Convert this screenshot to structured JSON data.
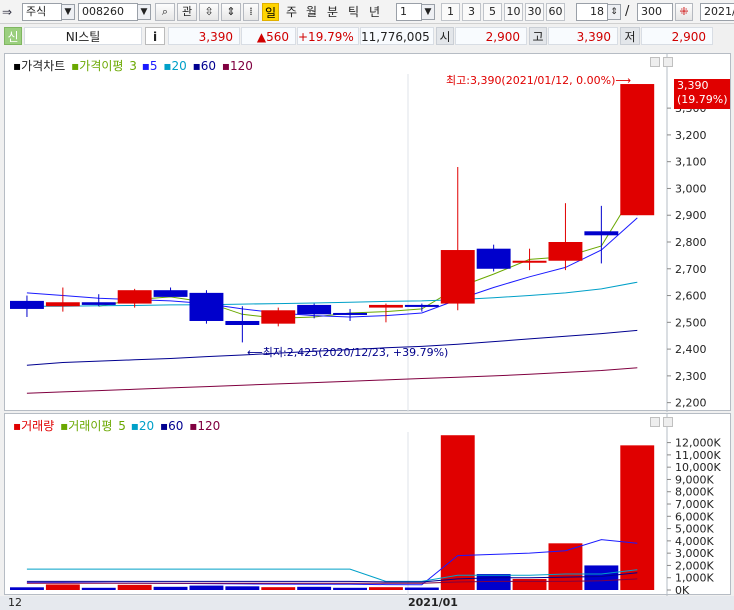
{
  "toolbar": {
    "market_value": "주식",
    "code_value": "008260",
    "watch_label": "관",
    "periods": [
      "일",
      "주",
      "월",
      "분",
      "틱",
      "년"
    ],
    "active_period": "일",
    "interval_value": "1",
    "interval_buttons": [
      "1",
      "3",
      "5",
      "10",
      "30",
      "60"
    ],
    "view_count": "18",
    "total_count": "300",
    "date_value": "2021/"
  },
  "info": {
    "credit_label": "신",
    "name": "NI스틸",
    "info_icon": "i",
    "price": "3,390",
    "change": "▲560",
    "change_rate": "+19.79%",
    "volume": "11,776,005",
    "open_label": "시",
    "open": "2,900",
    "high_label": "고",
    "high": "3,390",
    "low_label": "저",
    "low": "2,900"
  },
  "price_pane": {
    "legend": [
      "가격차트",
      "가격이평",
      "3",
      "5",
      "20",
      "60",
      "120"
    ],
    "max_annotation": "최고:3,390(2021/01/12, 0.00%)⟶",
    "min_annotation": "⟵최저:2,425(2020/12/23, +39.79%)",
    "current_price_tag": "3,390",
    "current_rate_tag": "(19.79%)"
  },
  "volume_pane": {
    "legend": [
      "거래량",
      "거래이평",
      "5",
      "20",
      "60",
      "120"
    ]
  },
  "x_axis": {
    "left_label": "12",
    "month_label": "2021/01"
  },
  "colors": {
    "up": "#e00000",
    "down": "#0000cc",
    "ma3": "#6aa800",
    "ma5": "#1a1aff",
    "ma20": "#00a0c8",
    "ma60": "#000090",
    "ma120": "#800040",
    "active_period_bg": "#ffd400"
  },
  "chart_data": [
    {
      "type": "candlestick",
      "title": "가격차트",
      "y_ticks": [
        2200,
        2300,
        2400,
        2500,
        2600,
        2700,
        2800,
        2900,
        3000,
        3100,
        3200,
        3300
      ],
      "ylim": [
        2180,
        3420
      ],
      "candles": [
        {
          "o": 2580,
          "h": 2600,
          "l": 2520,
          "c": 2550
        },
        {
          "o": 2560,
          "h": 2630,
          "l": 2540,
          "c": 2575
        },
        {
          "o": 2575,
          "h": 2605,
          "l": 2560,
          "c": 2565
        },
        {
          "o": 2570,
          "h": 2625,
          "l": 2555,
          "c": 2620
        },
        {
          "o": 2620,
          "h": 2630,
          "l": 2600,
          "c": 2595
        },
        {
          "o": 2610,
          "h": 2620,
          "l": 2495,
          "c": 2505
        },
        {
          "o": 2505,
          "h": 2560,
          "l": 2425,
          "c": 2490
        },
        {
          "o": 2495,
          "h": 2555,
          "l": 2485,
          "c": 2545
        },
        {
          "o": 2565,
          "h": 2570,
          "l": 2515,
          "c": 2530
        },
        {
          "o": 2535,
          "h": 2550,
          "l": 2505,
          "c": 2530
        },
        {
          "o": 2555,
          "h": 2570,
          "l": 2500,
          "c": 2565
        },
        {
          "o": 2565,
          "h": 2570,
          "l": 2540,
          "c": 2560
        },
        {
          "o": 2570,
          "h": 3080,
          "l": 2545,
          "c": 2770
        },
        {
          "o": 2775,
          "h": 2790,
          "l": 2690,
          "c": 2700
        },
        {
          "o": 2730,
          "h": 2775,
          "l": 2695,
          "c": 2730
        },
        {
          "o": 2730,
          "h": 2945,
          "l": 2695,
          "c": 2800
        },
        {
          "o": 2840,
          "h": 2935,
          "l": 2720,
          "c": 2825
        },
        {
          "o": 2900,
          "h": 3390,
          "l": 2900,
          "c": 3390
        }
      ],
      "series": [
        {
          "name": "3",
          "values": [
            null,
            null,
            2560,
            2585,
            2595,
            2575,
            2530,
            2515,
            2520,
            2535,
            2540,
            2550,
            2630,
            2680,
            2735,
            2745,
            2785,
            3005
          ]
        },
        {
          "name": "5",
          "values": [
            2610,
            2600,
            2590,
            2585,
            2580,
            2570,
            2550,
            2535,
            2525,
            2520,
            2525,
            2535,
            2585,
            2630,
            2670,
            2705,
            2770,
            2890
          ]
        },
        {
          "name": "20",
          "values": [
            2560,
            2560,
            2562,
            2563,
            2565,
            2566,
            2568,
            2570,
            2572,
            2575,
            2578,
            2580,
            2585,
            2592,
            2600,
            2610,
            2625,
            2650
          ]
        },
        {
          "name": "60",
          "values": [
            2340,
            2350,
            2355,
            2360,
            2365,
            2372,
            2378,
            2385,
            2392,
            2398,
            2405,
            2410,
            2418,
            2428,
            2438,
            2448,
            2458,
            2470
          ]
        },
        {
          "name": "120",
          "values": [
            2235,
            2240,
            2245,
            2250,
            2255,
            2260,
            2265,
            2270,
            2275,
            2280,
            2285,
            2290,
            2295,
            2300,
            2306,
            2313,
            2320,
            2330
          ]
        }
      ]
    },
    {
      "type": "bar",
      "title": "거래량",
      "y_ticks": [
        "0K",
        "1,000K",
        "2,000K",
        "3,000K",
        "4,000K",
        "5,000K",
        "6,000K",
        "7,000K",
        "8,000K",
        "9,000K",
        "10,000K",
        "11,000K",
        "12,000K"
      ],
      "ylim": [
        0,
        12700
      ],
      "values": [
        220,
        450,
        180,
        420,
        260,
        360,
        300,
        230,
        260,
        180,
        230,
        200,
        12600,
        1300,
        900,
        3800,
        2000,
        11776
      ],
      "up": [
        false,
        true,
        false,
        true,
        false,
        false,
        false,
        true,
        false,
        false,
        true,
        false,
        true,
        false,
        true,
        true,
        false,
        true
      ],
      "series": [
        {
          "name": "5",
          "values": [
            600,
            600,
            580,
            560,
            540,
            520,
            500,
            480,
            470,
            460,
            440,
            420,
            2800,
            2900,
            3000,
            3200,
            4100,
            3800
          ]
        },
        {
          "name": "20",
          "values": [
            1700,
            1700,
            1700,
            1700,
            1700,
            1700,
            1700,
            1700,
            1700,
            1700,
            700,
            700,
            1200,
            1200,
            1200,
            1300,
            1300,
            1650
          ]
        },
        {
          "name": "60",
          "values": [
            700,
            700,
            700,
            700,
            700,
            700,
            700,
            700,
            700,
            700,
            650,
            650,
            900,
            1000,
            1000,
            1050,
            1100,
            1400
          ]
        },
        {
          "name": "120",
          "values": [
            550,
            550,
            550,
            550,
            550,
            550,
            550,
            550,
            550,
            550,
            550,
            550,
            650,
            700,
            700,
            700,
            750,
            900
          ]
        }
      ]
    }
  ]
}
